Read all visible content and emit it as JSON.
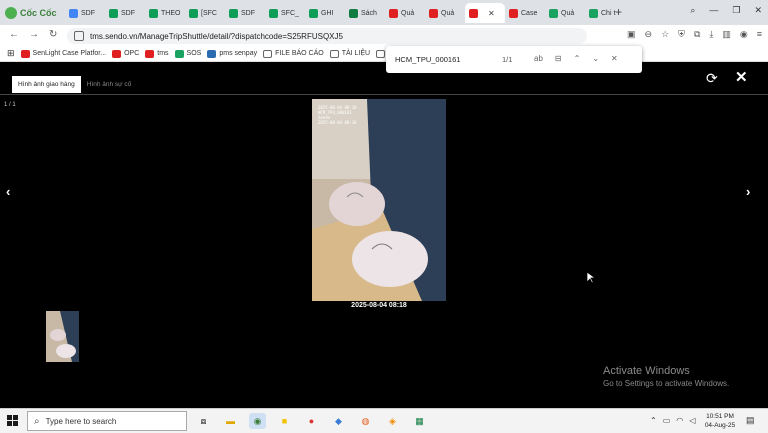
{
  "browser": {
    "brand": "Cốc Cốc",
    "tabs": [
      {
        "label": "SDF",
        "icon": "drive-icon",
        "color": "#4285f4"
      },
      {
        "label": "SDF",
        "icon": "sheets-icon",
        "color": "#0f9d58"
      },
      {
        "label": "THEO",
        "icon": "sheets-icon",
        "color": "#0f9d58"
      },
      {
        "label": "[SFC",
        "icon": "sheets-icon",
        "color": "#0f9d58"
      },
      {
        "label": "SDF",
        "icon": "sheets-icon",
        "color": "#0f9d58"
      },
      {
        "label": "SFC_",
        "icon": "sheets-icon",
        "color": "#0f9d58"
      },
      {
        "label": "GHI",
        "icon": "sheets-icon",
        "color": "#0f9d58"
      },
      {
        "label": "Sách",
        "icon": "excel-icon",
        "color": "#107c41"
      },
      {
        "label": "Quả",
        "icon": "sendo-icon",
        "color": "#e02020"
      },
      {
        "label": "Quả",
        "icon": "sendo-icon",
        "color": "#e02020"
      },
      {
        "label": "",
        "icon": "sendo-icon",
        "color": "#e02020",
        "active": true
      },
      {
        "label": "Case",
        "icon": "sendo-icon",
        "color": "#e02020"
      },
      {
        "label": "Quả",
        "icon": "s-icon",
        "color": "#1aa260"
      },
      {
        "label": "Chi t",
        "icon": "s-icon",
        "color": "#1aa260"
      }
    ],
    "url": "tms.sendo.vn/ManageTripShuttle/detail/?dispatchcode=S25RFUSQXJ5",
    "bookmarks": [
      {
        "label": "SenLight Case Platfor...",
        "icon": "sendo-icon",
        "color": "#e02020"
      },
      {
        "label": "OPC",
        "icon": "sendo-icon",
        "color": "#e02020"
      },
      {
        "label": "tms",
        "icon": "sendo-icon",
        "color": "#e02020"
      },
      {
        "label": "SOS",
        "icon": "s-icon",
        "color": "#1aa260"
      },
      {
        "label": "pms senpay",
        "icon": "p-icon",
        "color": "#2b6cb0"
      },
      {
        "label": "FILE BÁO CÁO",
        "icon": "folder-icon",
        "color": "#666666"
      },
      {
        "label": "TÀI LIỆU",
        "icon": "folder-icon",
        "color": "#666666"
      },
      {
        "label": "FIL",
        "icon": "folder-icon",
        "color": "#666666"
      }
    ]
  },
  "find": {
    "query": "HCM_TPU_000161",
    "count": "1/1",
    "ab_label": "ab"
  },
  "viewer": {
    "tab_delivery": "Hình ảnh giao hàng",
    "tab_incident": "Hình ảnh sự cố",
    "counter": "1 / 1",
    "caption": "2025-08-04 08:18",
    "photo_stamp": [
      "2025-08-04 08:18",
      "HCM_TPU_000161",
      "Sendo",
      "2025-08-04 08:18"
    ]
  },
  "watermark": {
    "line1": "Activate Windows",
    "line2": "Go to Settings to activate Windows."
  },
  "taskbar": {
    "search_placeholder": "Type here to search",
    "time": "10:51 PM",
    "date": "04-Aug-25"
  }
}
